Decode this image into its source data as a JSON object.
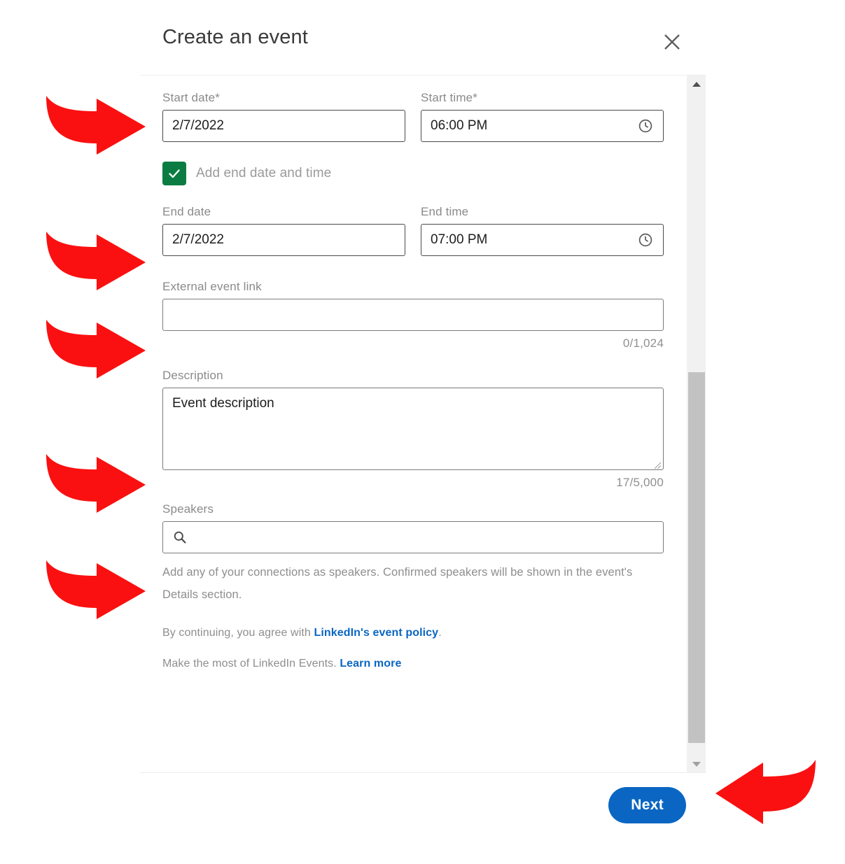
{
  "modal": {
    "title": "Create an event",
    "close_icon": "close-icon"
  },
  "form": {
    "start_date": {
      "label": "Start date",
      "required_mark": "*",
      "value": "2/7/2022",
      "placeholder": ""
    },
    "start_time": {
      "label": "Start time",
      "required_mark": "*",
      "value": "06:00 PM",
      "placeholder": "",
      "icon": "clock-icon"
    },
    "add_end": {
      "label": "Add end date and time",
      "checked": true,
      "check_color": "#0a7c42"
    },
    "end_date": {
      "label": "End date",
      "value": "2/7/2022",
      "placeholder": ""
    },
    "end_time": {
      "label": "End time",
      "value": "07:00 PM",
      "placeholder": "",
      "icon": "clock-icon"
    },
    "external_link": {
      "label": "External event link",
      "value": "",
      "placeholder": "",
      "counter": "0/1,024"
    },
    "description": {
      "label": "Description",
      "value": "Event description",
      "placeholder": "",
      "counter": "17/5,000"
    },
    "speakers": {
      "label": "Speakers",
      "value": "",
      "placeholder": "",
      "icon": "search-icon",
      "helper": "Add any of your connections as speakers. Confirmed speakers will be shown in the event's Details section."
    }
  },
  "legal": {
    "line1_prefix": "By continuing, you agree with ",
    "line1_link": "LinkedIn's event policy",
    "line1_suffix": ".",
    "line2_prefix": "Make the most of LinkedIn Events. ",
    "line2_link": "Learn more",
    "link_color": "#0a66c2"
  },
  "footer": {
    "next_label": "Next",
    "next_color": "#0a66c2"
  },
  "scrollbar": {
    "up_icon": "scroll-up-arrow-icon",
    "down_icon": "scroll-down-arrow-icon",
    "thumb": "scrollbar-thumb"
  },
  "annotations": {
    "arrow_color": "#fa1010",
    "arrows": [
      {
        "name": "arrow-start-date",
        "direction": "right"
      },
      {
        "name": "arrow-end-date",
        "direction": "right"
      },
      {
        "name": "arrow-external-link",
        "direction": "right"
      },
      {
        "name": "arrow-description",
        "direction": "right"
      },
      {
        "name": "arrow-speakers",
        "direction": "right"
      },
      {
        "name": "arrow-next-button",
        "direction": "left"
      }
    ]
  }
}
